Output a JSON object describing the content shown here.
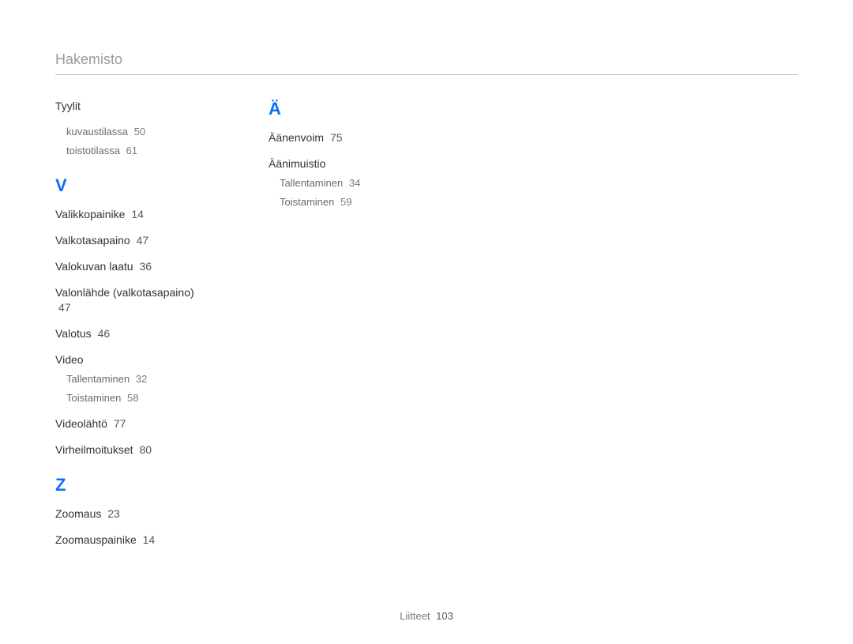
{
  "header": {
    "title": "Hakemisto"
  },
  "col1": {
    "groupA": {
      "title": "Tyylit",
      "subs": [
        {
          "label": "kuvaustilassa",
          "page": "50"
        },
        {
          "label": "toistotilassa",
          "page": "61"
        }
      ]
    },
    "letterV": "V",
    "v": {
      "e1": {
        "label": "Valikkopainike",
        "page": "14"
      },
      "e2": {
        "label": "Valkotasapaino",
        "page": "47"
      },
      "e3": {
        "label": "Valokuvan laatu",
        "page": "36"
      },
      "e4": {
        "label": "Valonlähde (valkotasapaino)",
        "page": "47"
      },
      "e5": {
        "label": "Valotus",
        "page": "46"
      },
      "e6": {
        "label": "Video"
      },
      "e6subs": [
        {
          "label": "Tallentaminen",
          "page": "32"
        },
        {
          "label": "Toistaminen",
          "page": "58"
        }
      ],
      "e7": {
        "label": "Videolähtö",
        "page": "77"
      },
      "e8": {
        "label": "Virheilmoitukset",
        "page": "80"
      }
    },
    "letterZ": "Z",
    "z": {
      "e1": {
        "label": "Zoomaus",
        "page": "23"
      },
      "e2": {
        "label": "Zoomauspainike",
        "page": "14"
      }
    }
  },
  "col2": {
    "letterA": "Ä",
    "a": {
      "e1": {
        "label": "Äänenvoim",
        "page": "75"
      },
      "e2": {
        "label": "Äänimuistio"
      },
      "e2subs": [
        {
          "label": "Tallentaminen",
          "page": "34"
        },
        {
          "label": "Toistaminen",
          "page": "59"
        }
      ]
    }
  },
  "footer": {
    "label": "Liitteet",
    "page": "103"
  }
}
